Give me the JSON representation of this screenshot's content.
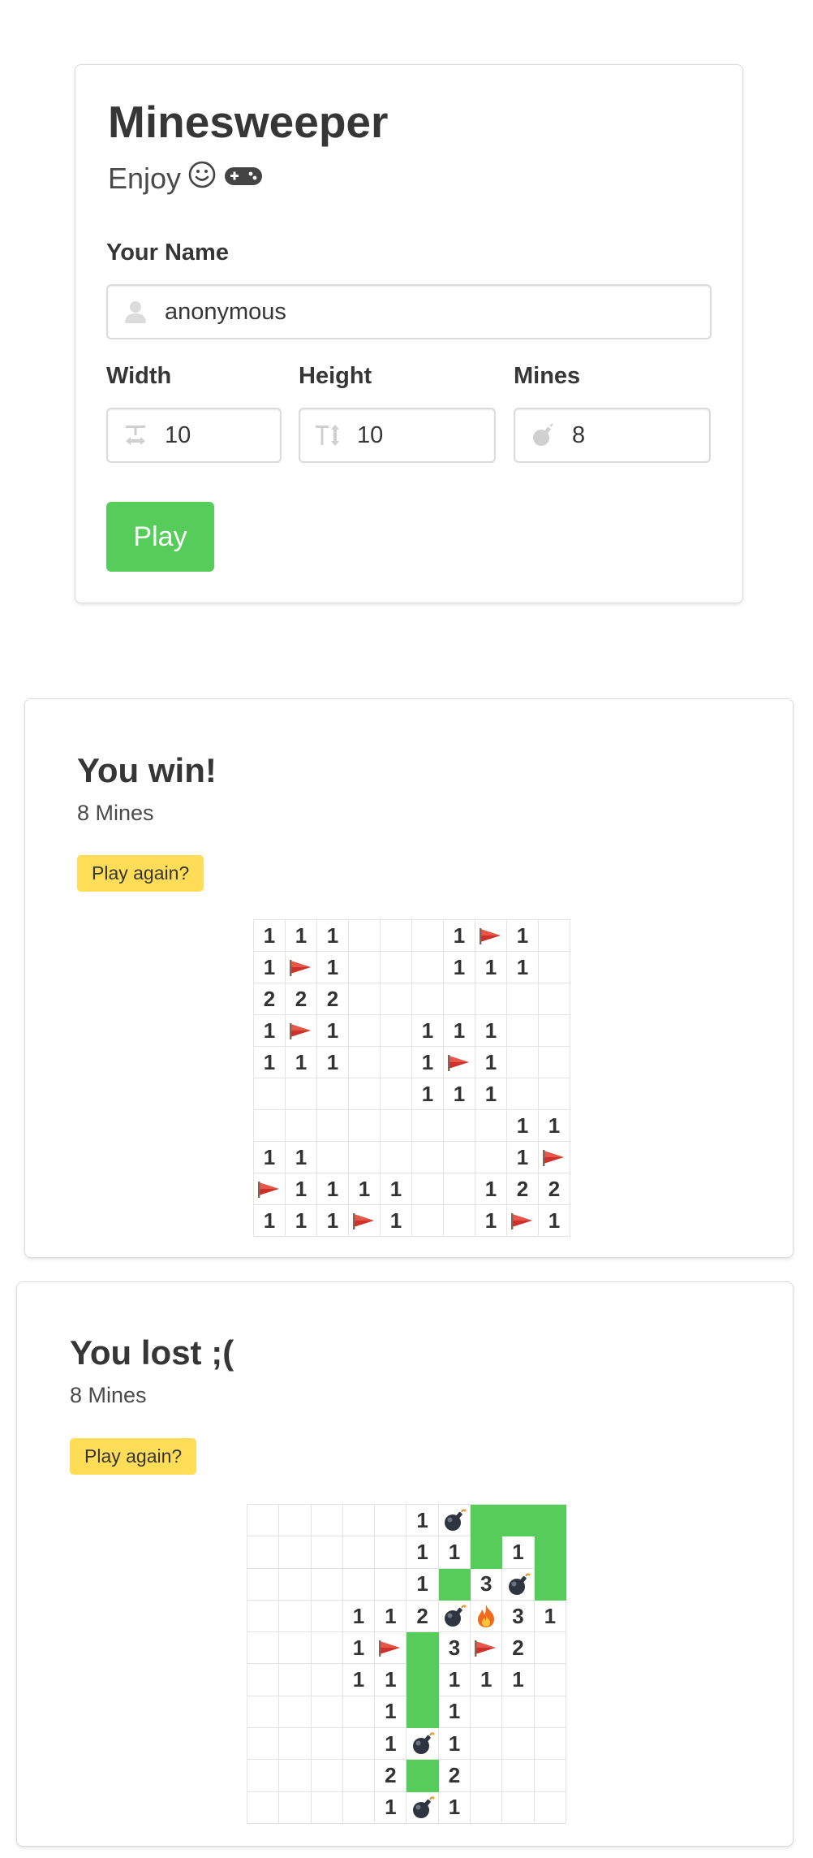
{
  "form": {
    "title": "Minesweeper",
    "subtitle": "Enjoy",
    "subtitle_icons": [
      "smiley-face-icon",
      "game-controller-icon"
    ],
    "name_label": "Your Name",
    "name_value": "anonymous",
    "width_label": "Width",
    "width_value": "10",
    "height_label": "Height",
    "height_value": "10",
    "mines_label": "Mines",
    "mines_value": "8",
    "play_label": "Play"
  },
  "colors": {
    "play_button": "#56cd5a",
    "again_button": "#ffdd57",
    "revealed_safe": "#56cd5a"
  },
  "win": {
    "title": "You win!",
    "mines_text": "8 Mines",
    "again_label": "Play again?",
    "board": [
      [
        "1",
        "1",
        "1",
        "",
        "",
        "",
        "1",
        "F",
        "1",
        ""
      ],
      [
        "1",
        "F",
        "1",
        "",
        "",
        "",
        "1",
        "1",
        "1",
        ""
      ],
      [
        "2",
        "2",
        "2",
        "",
        "",
        "",
        "",
        "",
        "",
        ""
      ],
      [
        "1",
        "F",
        "1",
        "",
        "",
        "1",
        "1",
        "1",
        "",
        ""
      ],
      [
        "1",
        "1",
        "1",
        "",
        "",
        "1",
        "F",
        "1",
        "",
        ""
      ],
      [
        "",
        "",
        "",
        "",
        "",
        "1",
        "1",
        "1",
        "",
        ""
      ],
      [
        "",
        "",
        "",
        "",
        "",
        "",
        "",
        "",
        "1",
        "1"
      ],
      [
        "1",
        "1",
        "",
        "",
        "",
        "",
        "",
        "",
        "1",
        "F"
      ],
      [
        "F",
        "1",
        "1",
        "1",
        "1",
        "",
        "",
        "1",
        "2",
        "2"
      ],
      [
        "1",
        "1",
        "1",
        "F",
        "1",
        "",
        "",
        "1",
        "F",
        "1"
      ]
    ]
  },
  "lost": {
    "title": "You lost ;(",
    "mines_text": "8 Mines",
    "again_label": "Play again?",
    "board": [
      [
        "",
        "",
        "",
        "",
        "",
        "1",
        "B",
        "G",
        "G",
        "G"
      ],
      [
        "",
        "",
        "",
        "",
        "",
        "1",
        "1",
        "G",
        "1",
        "G"
      ],
      [
        "",
        "",
        "",
        "",
        "",
        "1",
        "G",
        "3",
        "B",
        "G"
      ],
      [
        "",
        "",
        "",
        "1",
        "1",
        "2",
        "B",
        "X",
        "3",
        "1"
      ],
      [
        "",
        "",
        "",
        "1",
        "F",
        "G",
        "3",
        "F",
        "2",
        ""
      ],
      [
        "",
        "",
        "",
        "1",
        "1",
        "G",
        "1",
        "1",
        "1",
        ""
      ],
      [
        "",
        "",
        "",
        "",
        "1",
        "G",
        "1",
        "",
        "",
        ""
      ],
      [
        "",
        "",
        "",
        "",
        "1",
        "B",
        "1",
        "",
        "",
        ""
      ],
      [
        "",
        "",
        "",
        "",
        "2",
        "G",
        "2",
        "",
        "",
        ""
      ],
      [
        "",
        "",
        "",
        "",
        "1",
        "B",
        "1",
        "",
        "",
        ""
      ]
    ]
  }
}
